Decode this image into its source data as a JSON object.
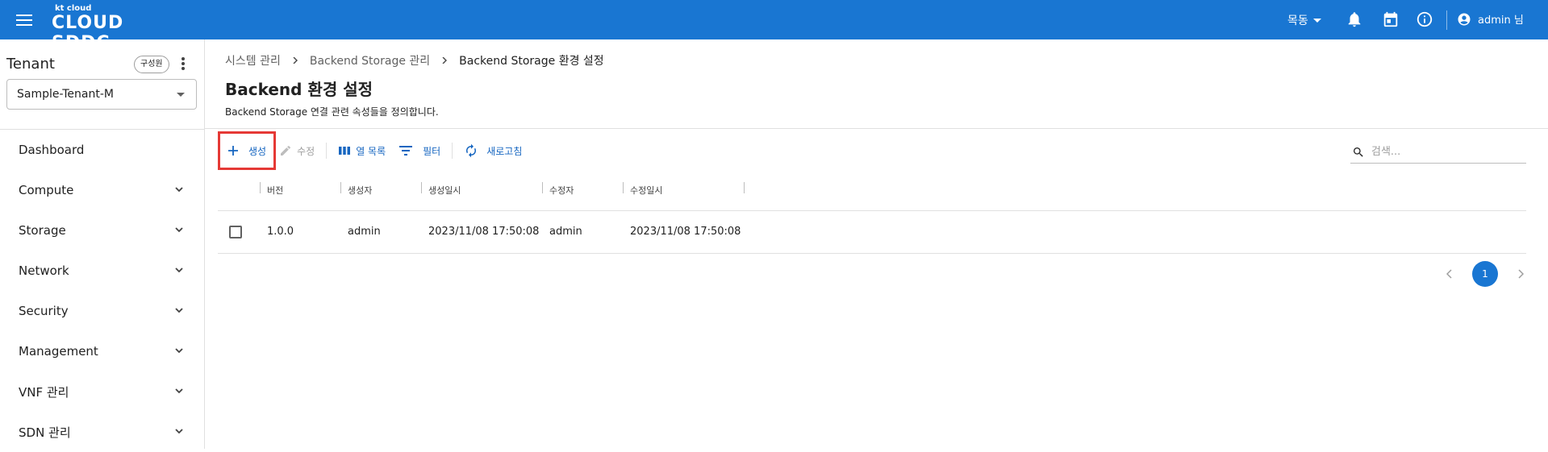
{
  "header": {
    "logo_small": "kt cloud",
    "logo_main": "CLOUD SDDC",
    "region": "목동",
    "user": "admin 님"
  },
  "sidebar": {
    "tenant_label": "Tenant",
    "member_chip": "구성원",
    "tenant_select_value": "Sample-Tenant-M",
    "items": [
      {
        "label": "Dashboard"
      },
      {
        "label": "Compute"
      },
      {
        "label": "Storage"
      },
      {
        "label": "Network"
      },
      {
        "label": "Security"
      },
      {
        "label": "Management"
      },
      {
        "label": "VNF 관리"
      },
      {
        "label": "SDN 관리"
      }
    ]
  },
  "breadcrumb": [
    "시스템 관리",
    "Backend Storage 관리",
    "Backend Storage 환경 설정"
  ],
  "page": {
    "title": "Backend 환경 설정",
    "description": "Backend Storage 연결 관련 속성들을 정의합니다."
  },
  "toolbar": {
    "create": "생성",
    "edit": "수정",
    "columns": "열 목록",
    "filter": "필터",
    "refresh": "새로고침"
  },
  "search": {
    "placeholder": "검색..."
  },
  "table": {
    "columns": [
      "버전",
      "생성자",
      "생성일시",
      "수정자",
      "수정일시"
    ],
    "rows": [
      [
        "1.0.0",
        "admin",
        "2023/11/08 17:50:08",
        "admin",
        "2023/11/08 17:50:08"
      ]
    ]
  },
  "pagination": {
    "current": "1"
  },
  "colors": {
    "primary": "#1976d2",
    "highlight": "#e53935"
  }
}
